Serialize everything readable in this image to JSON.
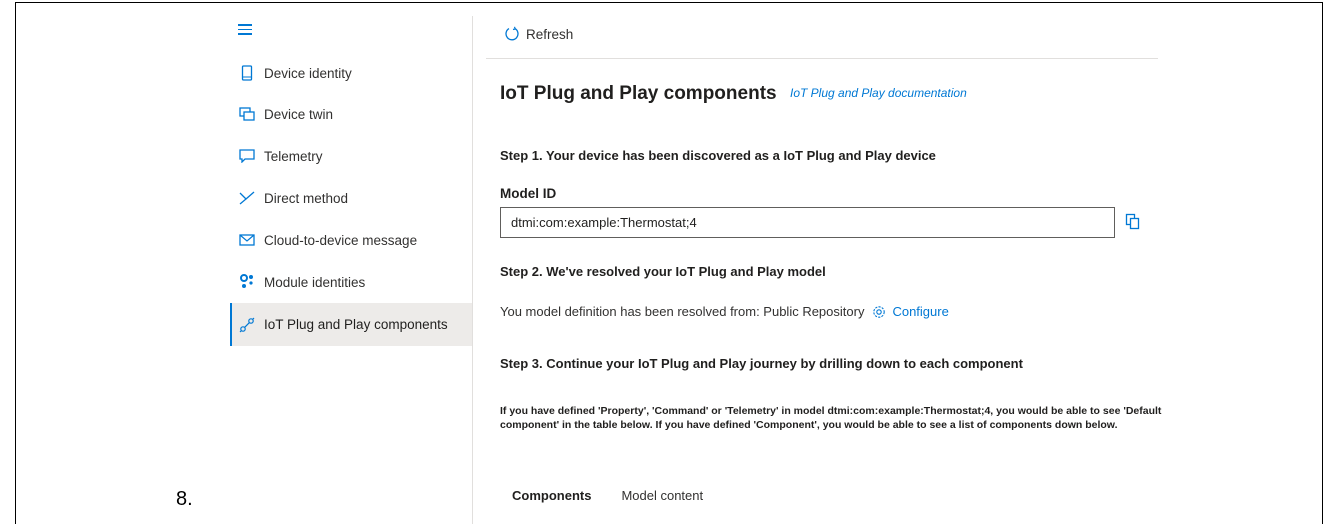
{
  "step_number": "8.",
  "sidebar": {
    "items": [
      {
        "label": "Device identity",
        "icon": "phone-icon"
      },
      {
        "label": "Device twin",
        "icon": "device-twin-icon"
      },
      {
        "label": "Telemetry",
        "icon": "chat-icon"
      },
      {
        "label": "Direct method",
        "icon": "direct-method-icon"
      },
      {
        "label": "Cloud-to-device message",
        "icon": "mail-icon"
      },
      {
        "label": "Module identities",
        "icon": "module-icon"
      },
      {
        "label": "IoT Plug and Play components",
        "icon": "plug-icon",
        "active": true
      }
    ]
  },
  "toolbar": {
    "refresh_label": "Refresh"
  },
  "main": {
    "title": "IoT Plug and Play components",
    "doc_link": "IoT Plug and Play documentation",
    "step1": "Step 1. Your device has been discovered as a IoT Plug and Play device",
    "model_id_label": "Model ID",
    "model_id_value": "dtmi:com:example:Thermostat;4",
    "step2": "Step 2. We've resolved your IoT Plug and Play model",
    "resolved_text": "You model definition has been resolved from: Public Repository",
    "configure_label": "Configure",
    "step3": "Step 3. Continue your IoT Plug and Play journey by drilling down to each component",
    "info_text": "If you have defined 'Property', 'Command' or 'Telemetry' in model dtmi:com:example:Thermostat;4, you would be able to see 'Default component' in the table below. If you have defined 'Component', you would be able to see a list of components down below.",
    "tabs": [
      "Components",
      "Model content"
    ]
  },
  "colors": {
    "accent": "#0078d4",
    "active_bg": "#edebe9"
  }
}
